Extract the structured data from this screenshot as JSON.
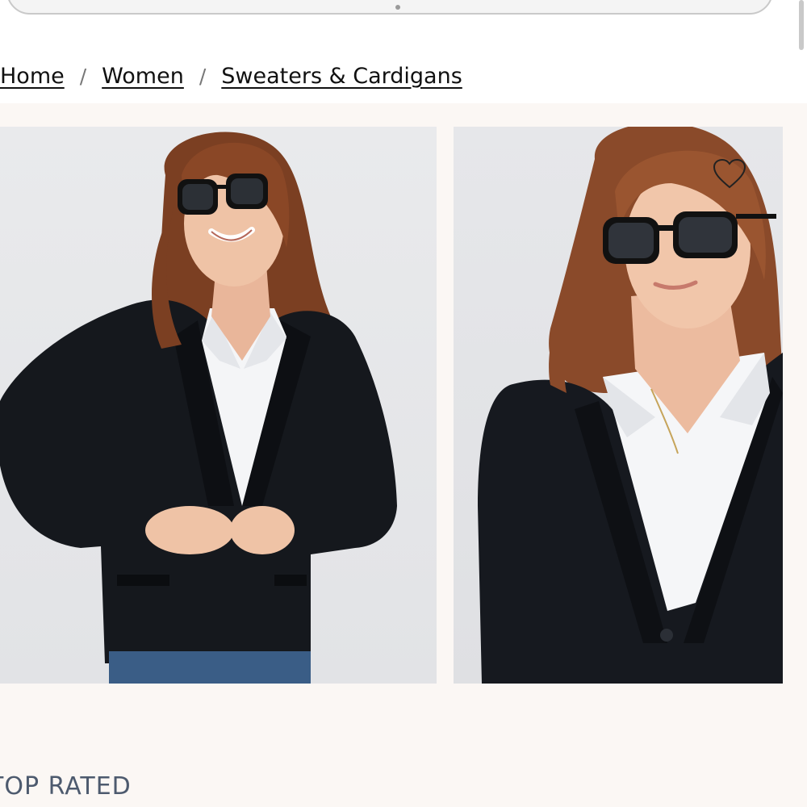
{
  "breadcrumb": {
    "items": [
      {
        "label": "Home"
      },
      {
        "label": "Women"
      },
      {
        "label": "Sweaters & Cardigans"
      }
    ],
    "separator": "/"
  },
  "gallery": {
    "images": [
      {
        "alt": "Model in black blazer, white shirt and sunglasses buttoning the jacket"
      },
      {
        "alt": "Close-up of model in black blazer, white shirt and sunglasses"
      }
    ],
    "wishlist_icon": "heart-outline-icon"
  },
  "section": {
    "title": "TOP RATED"
  },
  "colors": {
    "background": "#ffffff",
    "gallery_background": "#fbf7f4",
    "section_title": "#4d5a6e",
    "text": "#111111"
  }
}
